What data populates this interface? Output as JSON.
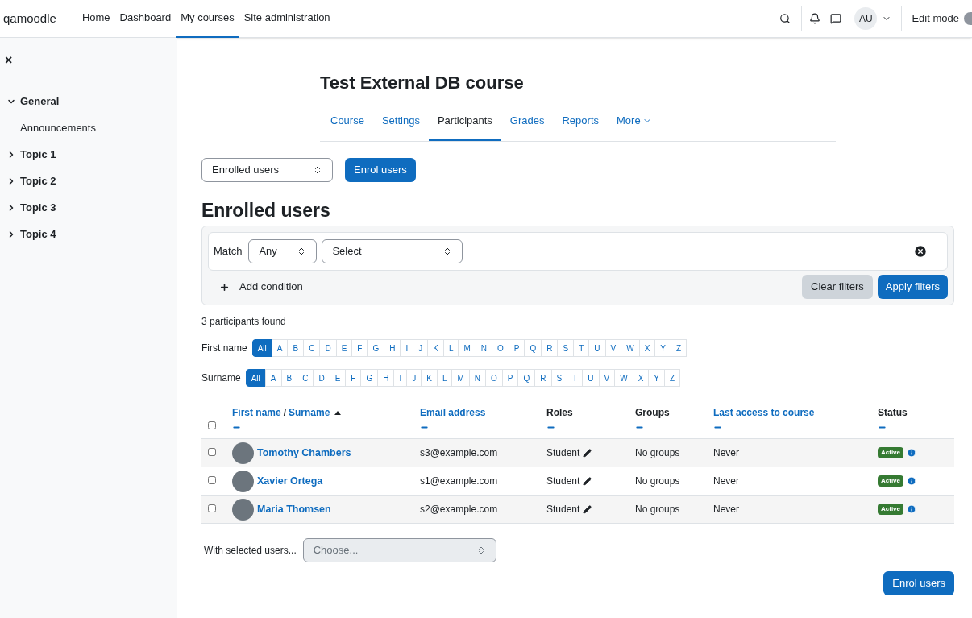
{
  "navbar": {
    "brand": "qamoodle",
    "links": [
      {
        "label": "Home",
        "selected": false
      },
      {
        "label": "Dashboard",
        "selected": false
      },
      {
        "label": "My courses",
        "selected": true
      },
      {
        "label": "Site administration",
        "selected": false
      }
    ],
    "avatar": "AU",
    "edit_mode": {
      "label": "Edit mode",
      "on": false
    }
  },
  "drawer": {
    "close": "×",
    "items": [
      {
        "label": "General",
        "expanded": true,
        "children": [
          {
            "label": "Announcements"
          }
        ]
      },
      {
        "label": "Topic 1",
        "expanded": false
      },
      {
        "label": "Topic 2",
        "expanded": false
      },
      {
        "label": "Topic 3",
        "expanded": false
      },
      {
        "label": "Topic 4",
        "expanded": false
      }
    ]
  },
  "course": {
    "title": "Test External DB course",
    "tabs": [
      {
        "label": "Course",
        "selected": false
      },
      {
        "label": "Settings",
        "selected": false
      },
      {
        "label": "Participants",
        "selected": true
      },
      {
        "label": "Grades",
        "selected": false
      },
      {
        "label": "Reports",
        "selected": false
      },
      {
        "label": "More",
        "selected": false
      }
    ]
  },
  "page_select": "Enrolled users",
  "enrol_button": "Enrol users",
  "heading": "Enrolled users",
  "filter": {
    "match_label": "Match",
    "match_value": "Any",
    "type_value": "Select",
    "add_condition": "Add condition",
    "clear": "Clear filters",
    "apply": "Apply filters"
  },
  "found": "3 participants found",
  "initials": [
    {
      "label": "First name",
      "letters": [
        {
          "label": "All",
          "selected": true
        },
        {
          "label": "A",
          "selected": false
        },
        {
          "label": "B",
          "selected": false
        },
        {
          "label": "C",
          "selected": false
        },
        {
          "label": "D",
          "selected": false
        },
        {
          "label": "E",
          "selected": false
        },
        {
          "label": "F",
          "selected": false
        },
        {
          "label": "G",
          "selected": false
        },
        {
          "label": "H",
          "selected": false
        },
        {
          "label": "I",
          "selected": false
        },
        {
          "label": "J",
          "selected": false
        },
        {
          "label": "K",
          "selected": false
        },
        {
          "label": "L",
          "selected": false
        },
        {
          "label": "M",
          "selected": false
        },
        {
          "label": "N",
          "selected": false
        },
        {
          "label": "O",
          "selected": false
        },
        {
          "label": "P",
          "selected": false
        },
        {
          "label": "Q",
          "selected": false
        },
        {
          "label": "R",
          "selected": false
        },
        {
          "label": "S",
          "selected": false
        },
        {
          "label": "T",
          "selected": false
        },
        {
          "label": "U",
          "selected": false
        },
        {
          "label": "V",
          "selected": false
        },
        {
          "label": "W",
          "selected": false
        },
        {
          "label": "X",
          "selected": false
        },
        {
          "label": "Y",
          "selected": false
        },
        {
          "label": "Z",
          "selected": false
        }
      ]
    },
    {
      "label": "Surname",
      "letters": [
        {
          "label": "All",
          "selected": true
        },
        {
          "label": "A",
          "selected": false
        },
        {
          "label": "B",
          "selected": false
        },
        {
          "label": "C",
          "selected": false
        },
        {
          "label": "D",
          "selected": false
        },
        {
          "label": "E",
          "selected": false
        },
        {
          "label": "F",
          "selected": false
        },
        {
          "label": "G",
          "selected": false
        },
        {
          "label": "H",
          "selected": false
        },
        {
          "label": "I",
          "selected": false
        },
        {
          "label": "J",
          "selected": false
        },
        {
          "label": "K",
          "selected": false
        },
        {
          "label": "L",
          "selected": false
        },
        {
          "label": "M",
          "selected": false
        },
        {
          "label": "N",
          "selected": false
        },
        {
          "label": "O",
          "selected": false
        },
        {
          "label": "P",
          "selected": false
        },
        {
          "label": "Q",
          "selected": false
        },
        {
          "label": "R",
          "selected": false
        },
        {
          "label": "S",
          "selected": false
        },
        {
          "label": "T",
          "selected": false
        },
        {
          "label": "U",
          "selected": false
        },
        {
          "label": "V",
          "selected": false
        },
        {
          "label": "W",
          "selected": false
        },
        {
          "label": "X",
          "selected": false
        },
        {
          "label": "Y",
          "selected": false
        },
        {
          "label": "Z",
          "selected": false
        }
      ]
    }
  ],
  "table": {
    "select_all": false,
    "columns": [
      {
        "labels": [
          "First name",
          "Surname"
        ],
        "separator": "/",
        "sortable": true,
        "sorted": true
      },
      {
        "labels": [
          "Email address"
        ],
        "sortable": true,
        "sorted": false
      },
      {
        "labels": [
          "Roles"
        ],
        "sortable": false,
        "sorted": false
      },
      {
        "labels": [
          "Groups"
        ],
        "sortable": false,
        "sorted": false
      },
      {
        "labels": [
          "Last access to course"
        ],
        "sortable": true,
        "sorted": false
      },
      {
        "labels": [
          "Status"
        ],
        "sortable": false,
        "sorted": false
      }
    ],
    "rows": [
      {
        "checked": false,
        "name": "Tomothy Chambers",
        "email": "s3@example.com",
        "role": "Student",
        "groups": "No groups",
        "last_access": "Never",
        "status": "Active"
      },
      {
        "checked": false,
        "name": "Xavier Ortega",
        "email": "s1@example.com",
        "role": "Student",
        "groups": "No groups",
        "last_access": "Never",
        "status": "Active"
      },
      {
        "checked": false,
        "name": "Maria Thomsen",
        "email": "s2@example.com",
        "role": "Student",
        "groups": "No groups",
        "last_access": "Never",
        "status": "Active"
      }
    ]
  },
  "bulk": {
    "label": "With selected users...",
    "placeholder": "Choose..."
  },
  "footer_button": "Enrol users"
}
